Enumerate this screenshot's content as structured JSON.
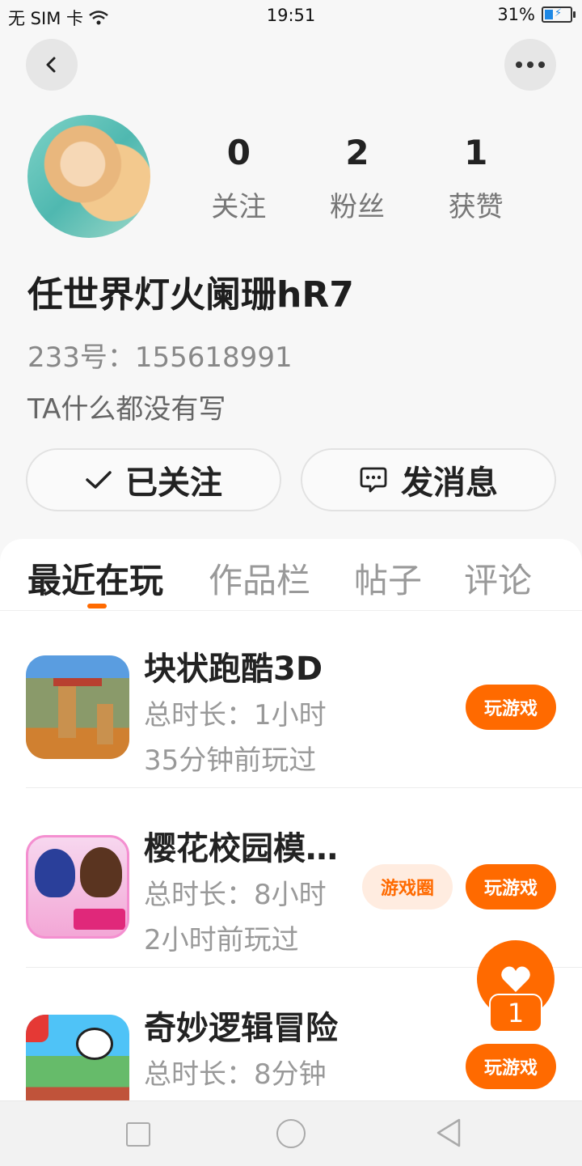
{
  "status_bar": {
    "carrier": "无 SIM 卡",
    "time": "19:51",
    "battery_pct": "31%"
  },
  "header": {
    "back_icon": "chevron-left-icon",
    "more_icon": "more-dots-icon"
  },
  "profile": {
    "stats": [
      {
        "value": "0",
        "label": "关注"
      },
      {
        "value": "2",
        "label": "粉丝"
      },
      {
        "value": "1",
        "label": "获赞"
      }
    ],
    "username": "任世界灯火阑珊hR7",
    "user_id": "233号：155618991",
    "bio": "TA什么都没有写",
    "follow_label": "已关注",
    "message_label": "发消息"
  },
  "tabs": [
    {
      "label": "最近在玩",
      "active": true
    },
    {
      "label": "作品栏",
      "active": false
    },
    {
      "label": "帖子",
      "active": false
    },
    {
      "label": "评论",
      "active": false
    }
  ],
  "games": [
    {
      "title": "块状跑酷3D",
      "duration": "总时长：1小时",
      "last_played": "35分钟前玩过",
      "play_label": "玩游戏"
    },
    {
      "title": "樱花校园模…",
      "duration": "总时长：8小时",
      "last_played": "2小时前玩过",
      "circle_label": "游戏圈",
      "play_label": "玩游戏"
    },
    {
      "title": "奇妙逻辑冒险",
      "duration": "总时长：8分钟",
      "last_played": "",
      "play_label": "玩游戏"
    }
  ],
  "like_fab": {
    "count": "1"
  },
  "colors": {
    "accent": "#ff6a00",
    "accent_light": "#ffece0"
  }
}
